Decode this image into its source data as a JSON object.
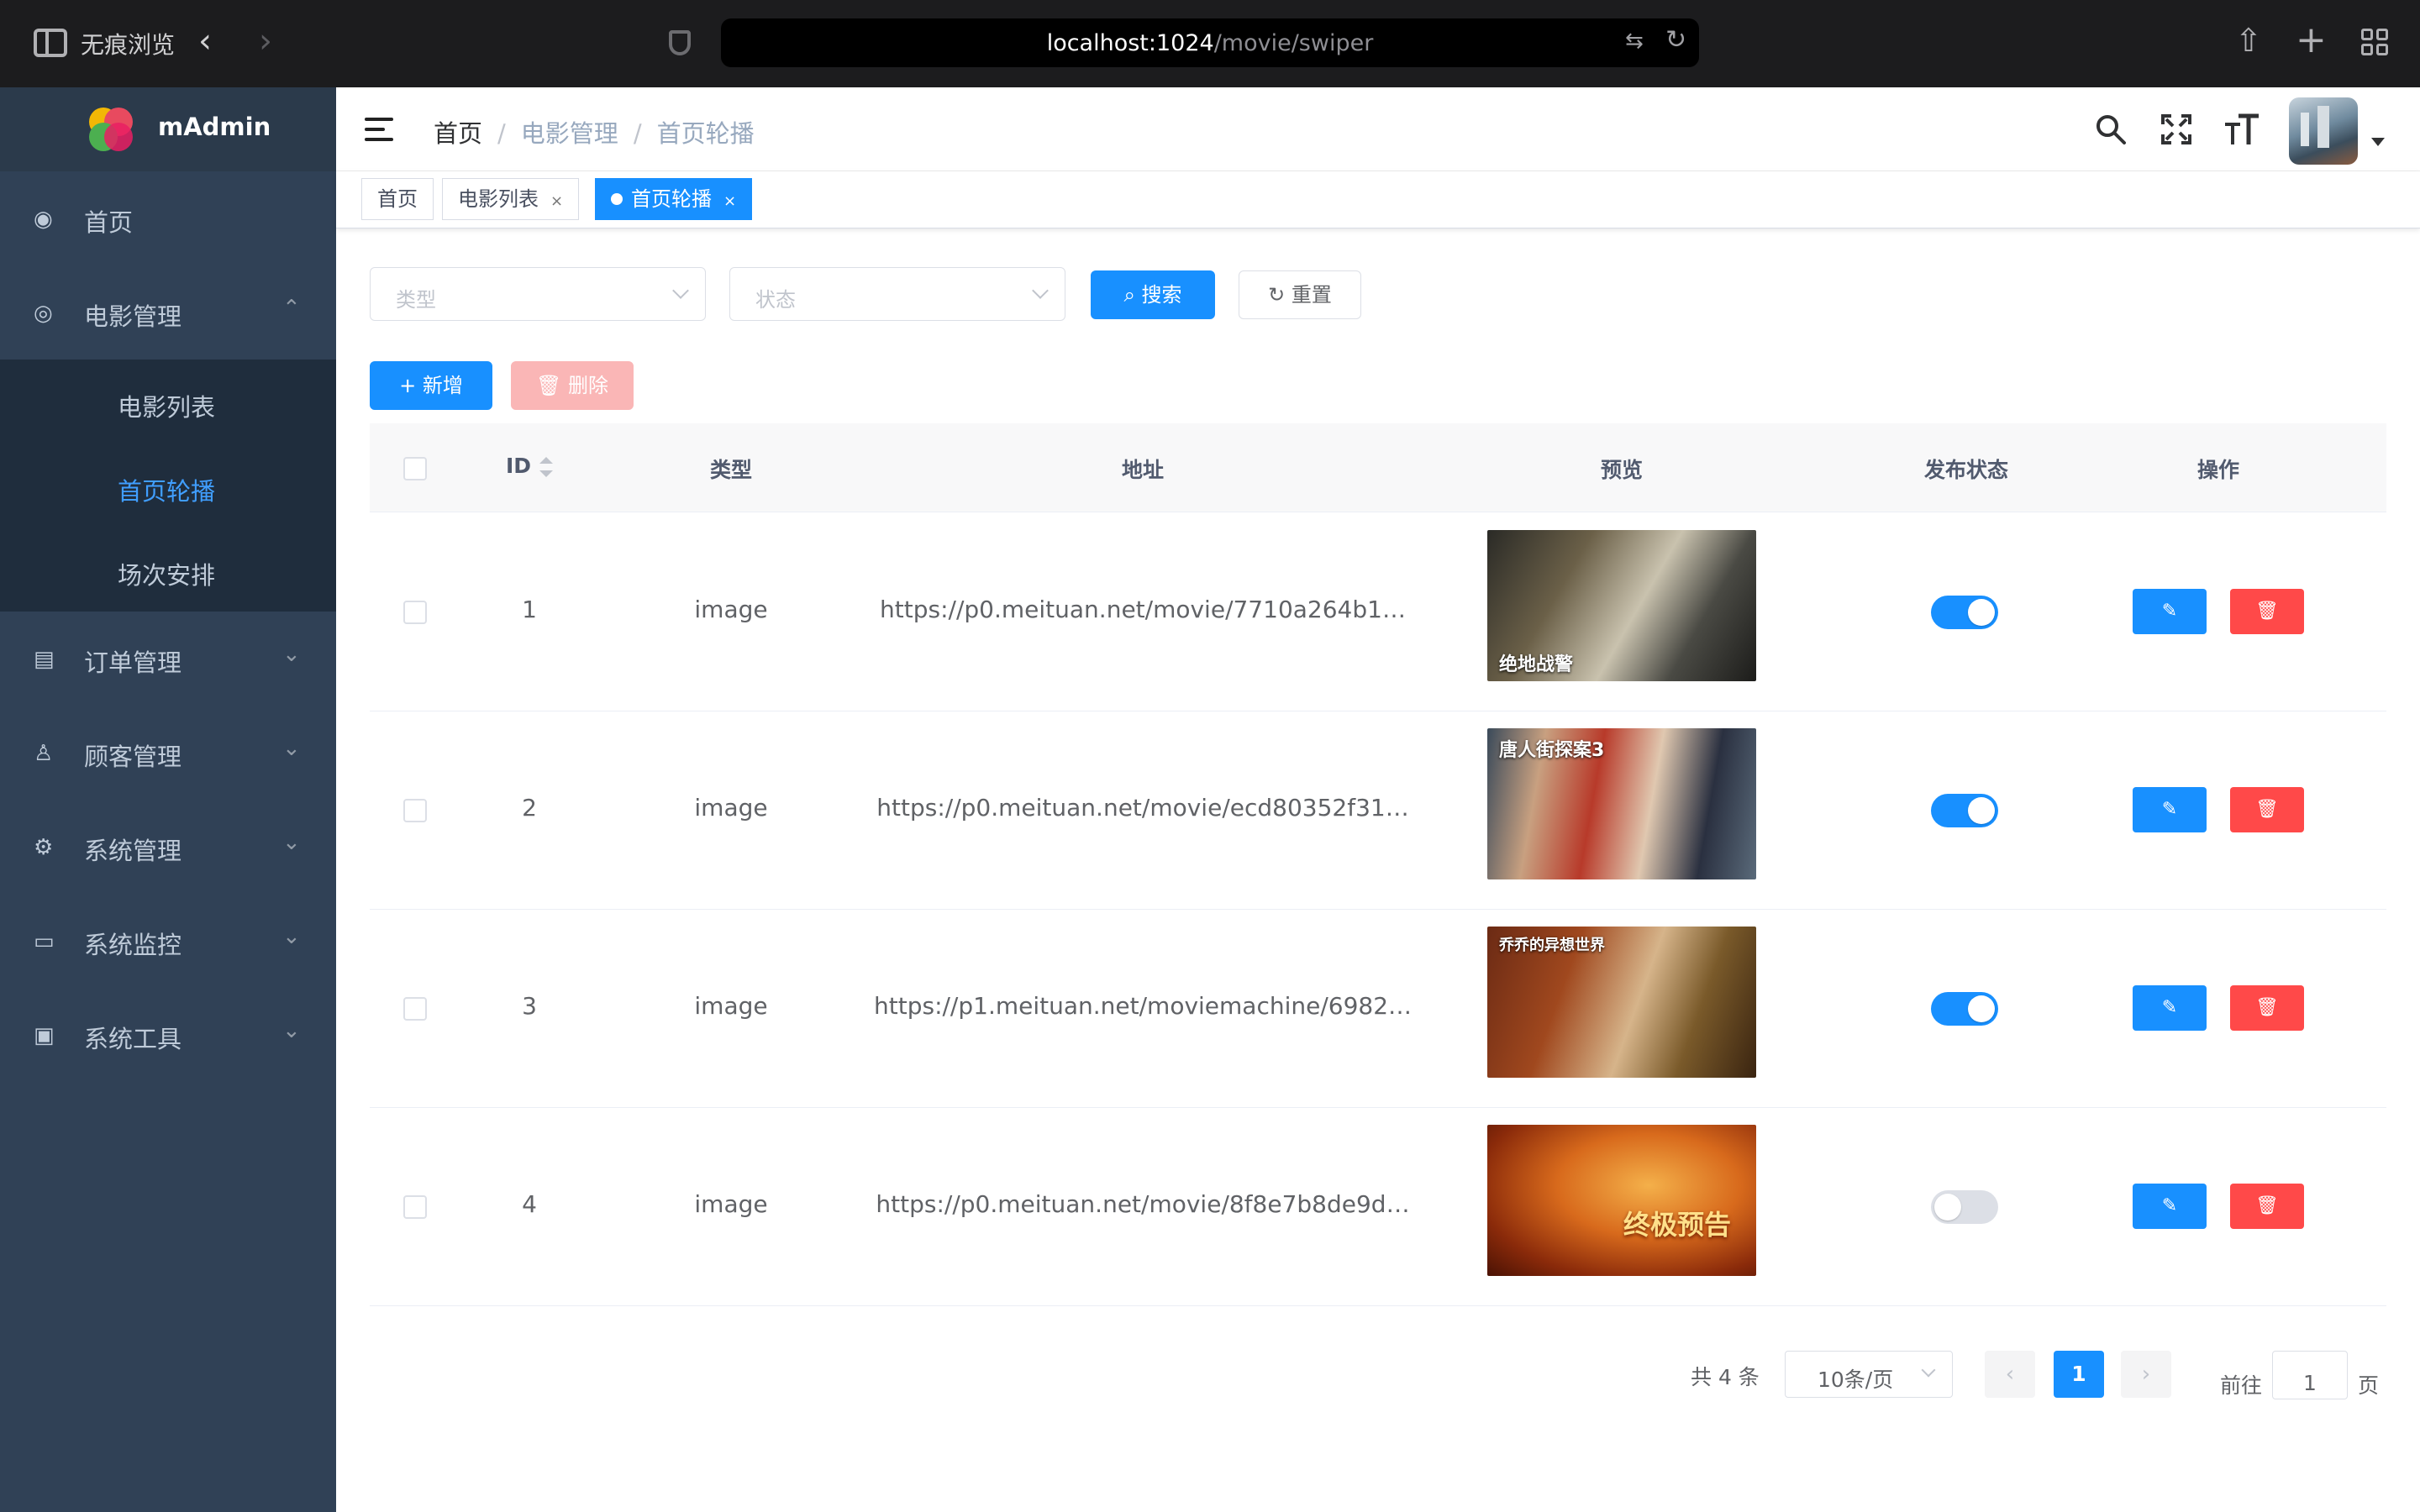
{
  "browser": {
    "private_label": "无痕浏览",
    "url_host": "localhost:1024",
    "url_path": "/movie/swiper"
  },
  "sidebar": {
    "title": "mAdmin",
    "items": [
      {
        "label": "首页",
        "icon": "dashboard-icon"
      },
      {
        "label": "电影管理",
        "icon": "film-icon",
        "expanded": true,
        "children": [
          {
            "label": "电影列表",
            "active": false
          },
          {
            "label": "首页轮播",
            "active": true
          },
          {
            "label": "场次安排",
            "active": false
          }
        ]
      },
      {
        "label": "订单管理",
        "icon": "order-icon"
      },
      {
        "label": "顾客管理",
        "icon": "user-icon"
      },
      {
        "label": "系统管理",
        "icon": "gear-icon"
      },
      {
        "label": "系统监控",
        "icon": "monitor-icon"
      },
      {
        "label": "系统工具",
        "icon": "toolbox-icon"
      }
    ]
  },
  "header": {
    "breadcrumb": [
      "首页",
      "电影管理",
      "首页轮播"
    ],
    "actions": [
      "search-icon",
      "fullscreen-icon",
      "font-size-icon"
    ]
  },
  "tags": [
    {
      "label": "首页",
      "active": false,
      "closable": false
    },
    {
      "label": "电影列表",
      "active": false,
      "closable": true
    },
    {
      "label": "首页轮播",
      "active": true,
      "closable": true
    }
  ],
  "filters": {
    "type_placeholder": "类型",
    "status_placeholder": "状态",
    "search_label": "搜索",
    "reset_label": "重置"
  },
  "toolbar": {
    "add_label": "新增",
    "delete_label": "删除"
  },
  "table": {
    "columns": [
      "ID",
      "类型",
      "地址",
      "预览",
      "发布状态",
      "操作"
    ],
    "rows": [
      {
        "id": "1",
        "type": "image",
        "url": "https://p0.meituan.net/movie/7710a264b1…",
        "preview_caption": "绝地战警",
        "published": true
      },
      {
        "id": "2",
        "type": "image",
        "url": "https://p0.meituan.net/movie/ecd80352f31…",
        "preview_caption": "唐人街探案3",
        "published": true
      },
      {
        "id": "3",
        "type": "image",
        "url": "https://p1.meituan.net/moviemachine/6982…",
        "preview_caption": "乔乔的异想世界",
        "published": true
      },
      {
        "id": "4",
        "type": "image",
        "url": "https://p0.meituan.net/movie/8f8e7b8de9d…",
        "preview_caption": "终极预告",
        "published": false
      }
    ]
  },
  "pagination": {
    "total_text": "共 4 条",
    "page_size": "10条/页",
    "current_page": "1",
    "goto_prefix": "前往",
    "goto_value": "1",
    "goto_suffix": "页"
  },
  "colors": {
    "primary": "#1890ff",
    "danger": "#ff4949",
    "sidebar_bg": "#304156",
    "sidebar_sub_bg": "#1f2d3d",
    "sidebar_active_text": "#409eff"
  }
}
